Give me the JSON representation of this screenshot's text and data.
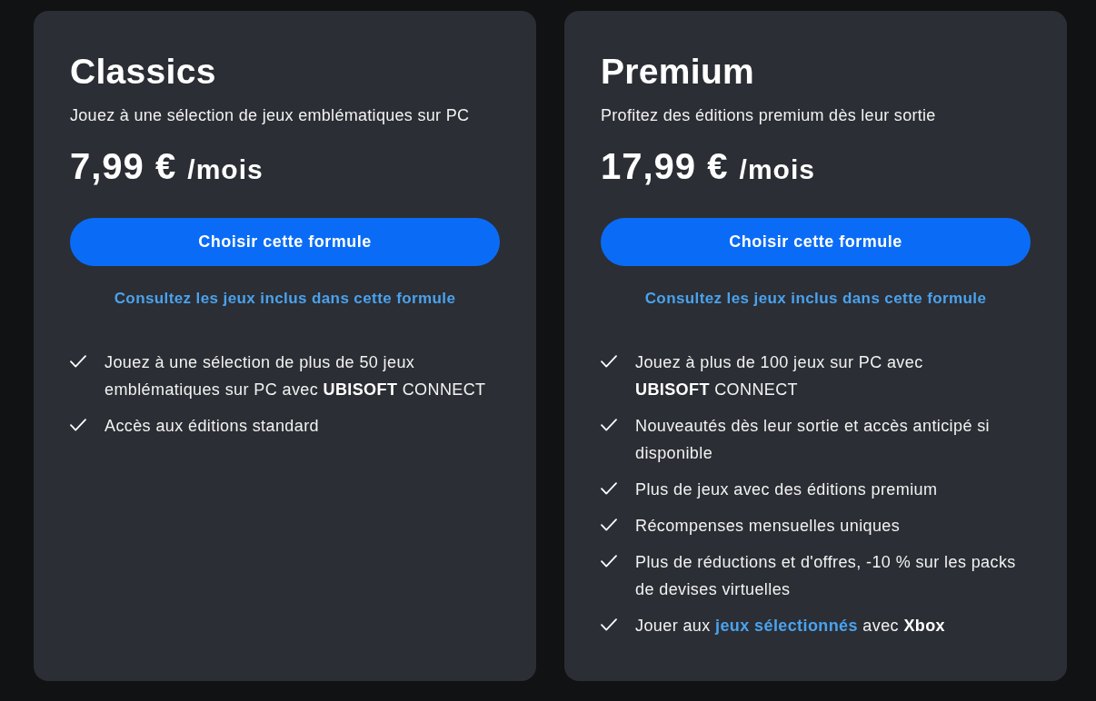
{
  "plans": [
    {
      "name": "Classics",
      "tagline": "Jouez à une sélection de jeux emblématiques sur PC",
      "price": "7,99 €",
      "period": "/mois",
      "cta": "Choisir cette formule",
      "games_link": "Consultez les jeux inclus dans cette formule",
      "features": [
        {
          "text": "Jouez à une sélection de plus de 50 jeux emblématiques sur PC avec",
          "brand": "**UBISOFT** CONNECT"
        },
        {
          "text": "Accès aux éditions standard"
        }
      ]
    },
    {
      "name": "Premium",
      "tagline": "Profitez des éditions premium dès leur sortie",
      "price": "17,99 €",
      "period": "/mois",
      "cta": "Choisir cette formule",
      "games_link": "Consultez les jeux inclus dans cette formule",
      "features": [
        {
          "text": "Jouez à plus de 100 jeux sur PC avec",
          "brand": "**UBISOFT** CONNECT"
        },
        {
          "text": "Nouveautés dès leur sortie et accès anticipé si disponible"
        },
        {
          "text": "Plus de jeux avec des éditions premium"
        },
        {
          "text": "Récompenses mensuelles uniques"
        },
        {
          "text": "Plus de réductions et d'offres, -10 % sur les packs de devises virtuelles"
        },
        {
          "text": "Jouer aux",
          "link": "jeux sélectionnés",
          "text_after": "avec **Xbox**"
        }
      ]
    }
  ]
}
